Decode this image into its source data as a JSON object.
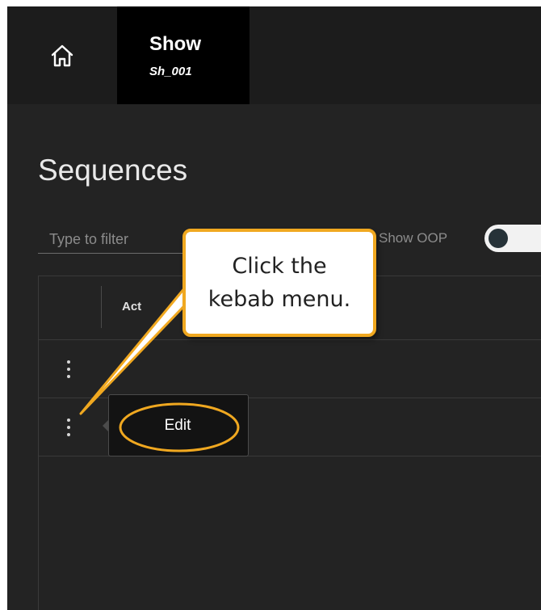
{
  "topbar": {
    "show_title": "Show",
    "show_code": "Sh_001",
    "home_icon": "home-icon"
  },
  "page": {
    "title": "Sequences"
  },
  "filter": {
    "placeholder": "Type to filter",
    "value": ""
  },
  "oop_toggle": {
    "label": "Show OOP",
    "checked": false
  },
  "table": {
    "header_label": "Actions",
    "header_visible_text": "Act",
    "rows": [
      {
        "menu_icon": "kebab-menu-icon"
      },
      {
        "menu_icon": "kebab-menu-icon"
      }
    ]
  },
  "context_menu": {
    "items": [
      {
        "label": "Edit"
      }
    ]
  },
  "callout": {
    "text": "Click the\nkebab menu.",
    "border_color": "#f0a820"
  }
}
